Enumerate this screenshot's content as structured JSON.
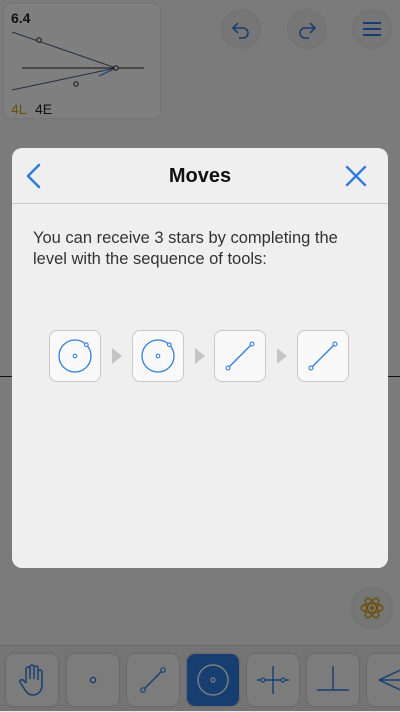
{
  "level": {
    "number": "6.4",
    "l_count": "4L",
    "e_count": "4E"
  },
  "top_buttons": [
    "undo-icon",
    "redo-icon",
    "menu-icon"
  ],
  "toolbar": {
    "tools": [
      "hand-icon",
      "point-icon",
      "line-icon",
      "circle-icon",
      "perpendicular-bisector-icon",
      "perpendicular-icon",
      "angle-bisector-icon"
    ],
    "active_tool": "circle-icon"
  },
  "dialog": {
    "title": "Moves",
    "message": "You can receive 3 stars by completing the level with the sequence of tools:",
    "sequence": [
      "circle-icon",
      "circle-icon",
      "line-icon",
      "line-icon"
    ],
    "accent": "#2f7de1"
  }
}
